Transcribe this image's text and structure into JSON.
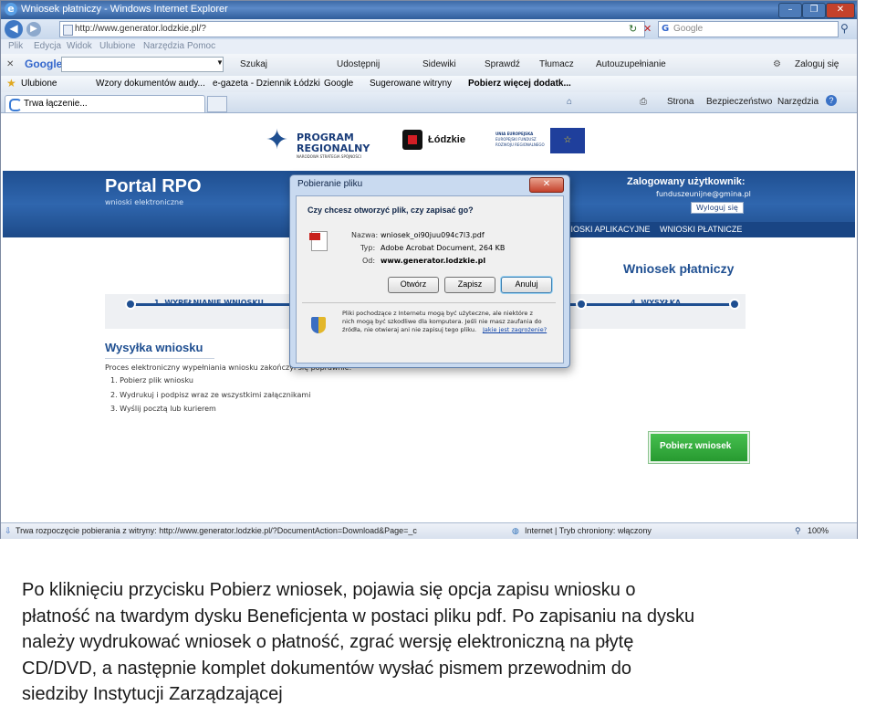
{
  "window": {
    "title": "Wniosek płatniczy - Windows Internet Explorer",
    "controls": [
      "–",
      "❐",
      "✕"
    ]
  },
  "address": {
    "url": "http://www.generator.lodzkie.pl/?",
    "search_placeholder": "Google"
  },
  "menu": [
    "Plik",
    "Edycja",
    "Widok",
    "Ulubione",
    "Narzędzia",
    "Pomoc"
  ],
  "google_toolbar": {
    "logo": "Google",
    "items": [
      "Szukaj",
      "Udostępnij",
      "Sidewiki",
      "Sprawdź",
      "Tłumacz",
      "Autouzupełnianie"
    ],
    "signin": "Zaloguj się"
  },
  "favorites": {
    "label": "Ulubione",
    "items": [
      "Wzory dokumentów audy...",
      "e-gazeta - Dziennik Łódzki",
      "Google",
      "Sugerowane witryny",
      "Pobierz więcej dodatk..."
    ]
  },
  "tab": {
    "label": "Trwa łączenie..."
  },
  "command_bar": [
    "Strona",
    "Bezpieczeństwo",
    "Narzędzia"
  ],
  "page": {
    "logo_program": [
      "PROGRAM",
      "REGIONALNY"
    ],
    "logo_program_sub": "NARODOWA STRATEGIA SPÓJNOŚCI",
    "logo_lodzkie": "Łódzkie",
    "logo_eu": [
      "UNIA EUROPEJSKA",
      "EUROPEJSKI FUNDUSZ",
      "ROZWOJU REGIONALNEGO"
    ],
    "portal_title": "Portal RPO",
    "portal_sub": "wnioski elektroniczne",
    "user_label": "Zalogowany użytkownik:",
    "user_email": "funduszeunijne@gmina.pl",
    "logout": "Wyloguj się",
    "nav": [
      "NIOSKI APLIKACYJNE",
      "WNIOSKI PŁATNICZE"
    ],
    "heading": "Wniosek płatniczy",
    "steps": [
      "1. WYPEŁNIANIE WNIOSKU",
      "4. WYSYŁKA"
    ],
    "section_title": "Wysyłka wniosku",
    "intro": "Proces elektroniczny wypełniania wniosku zakończył się poprawnie.",
    "list": [
      "1.  Pobierz plik wniosku",
      "2.  Wydrukuj i podpisz wraz ze wszystkimi załącznikami",
      "3.  Wyślij pocztą lub kurierem"
    ],
    "download_button": "Pobierz wniosek"
  },
  "dialog": {
    "title": "Pobieranie pliku",
    "question": "Czy chcesz otworzyć plik, czy zapisać go?",
    "name_label": "Nazwa:",
    "name_value": "wniosek_oi90juu094c7l3.pdf",
    "type_label": "Typ:",
    "type_value": "Adobe Acrobat Document, 264 KB",
    "from_label": "Od:",
    "from_value": "www.generator.lodzkie.pl",
    "buttons": [
      "Otwórz",
      "Zapisz",
      "Anuluj"
    ],
    "warning": [
      "Pliki pochodzące z Internetu mogą być użyteczne, ale niektóre z",
      "nich mogą być szkodliwe dla komputera. Jeśli nie masz zaufania do",
      "źródła, nie otwieraj ani nie zapisuj tego pliku."
    ],
    "risk_link": "Jakie jest zagrożenie?"
  },
  "status": {
    "left": "Trwa rozpoczęcie pobierania z witryny: http://www.generator.lodzkie.pl/?DocumentAction=Download&Page=_c",
    "zone": "Internet | Tryb chroniony: włączony",
    "zoom": "100%"
  },
  "caption": [
    "Po kliknięciu przycisku Pobierz wniosek, pojawia się opcja zapisu wniosku o",
    "płatność na twardym dysku Beneficjenta w postaci pliku pdf. Po zapisaniu na dysku",
    "należy wydrukować wniosek o płatność, zgrać wersję elektroniczną na płytę",
    "CD/DVD, a następnie komplet dokumentów wysłać pismem przewodnim do",
    "siedziby Instytucji Zarządzającej"
  ],
  "colors": {
    "banner": "#2f66ae",
    "accent": "#194584",
    "button_green": "#2fa23a",
    "heading_blue": "#1f4f91"
  }
}
